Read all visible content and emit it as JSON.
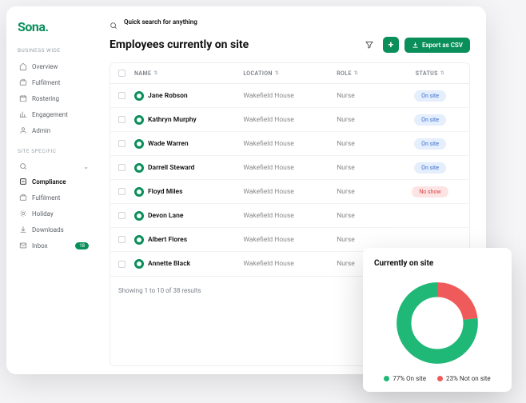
{
  "brand": {
    "name": "Sona",
    "dot": "."
  },
  "search": {
    "placeholder": "Quick search for anything"
  },
  "sidebar": {
    "section1_label": "BUSINESS WIDE",
    "section2_label": "SITE SPECIFIC",
    "items1": [
      {
        "label": "Overview"
      },
      {
        "label": "Fulfilment"
      },
      {
        "label": "Rostering"
      },
      {
        "label": "Engagement"
      },
      {
        "label": "Admin"
      }
    ],
    "items2": [
      {
        "label": "Compliance",
        "active": true
      },
      {
        "label": "Fulfilment"
      },
      {
        "label": "Holiday"
      },
      {
        "label": "Downloads"
      },
      {
        "label": "Inbox",
        "badge": "18"
      }
    ]
  },
  "page": {
    "title": "Employees currently on site",
    "export_label": "Export as CSV"
  },
  "table": {
    "headers": {
      "name": "NAME",
      "location": "LOCATION",
      "role": "ROLE",
      "status": "STATUS"
    },
    "rows": [
      {
        "name": "Jane Robson",
        "location": "Wakefield House",
        "role": "Nurse",
        "status": "On site",
        "status_class": "onsite"
      },
      {
        "name": "Kathryn Murphy",
        "location": "Wakefield House",
        "role": "Nurse",
        "status": "On site",
        "status_class": "onsite"
      },
      {
        "name": "Wade Warren",
        "location": "Wakefield House",
        "role": "Nurse",
        "status": "On site",
        "status_class": "onsite"
      },
      {
        "name": "Darrell Steward",
        "location": "Wakefield House",
        "role": "Nurse",
        "status": "On site",
        "status_class": "onsite"
      },
      {
        "name": "Floyd Miles",
        "location": "Wakefield House",
        "role": "Nurse",
        "status": "No show",
        "status_class": "noshow"
      },
      {
        "name": "Devon Lane",
        "location": "Wakefield House",
        "role": "Nurse",
        "status": "",
        "status_class": ""
      },
      {
        "name": "Albert Flores",
        "location": "Wakefield House",
        "role": "Nurse",
        "status": "",
        "status_class": ""
      },
      {
        "name": "Annette Black",
        "location": "Wakefield House",
        "role": "Nurse",
        "status": "",
        "status_class": ""
      }
    ],
    "footer": "Showing 1 to 10 of 38 results"
  },
  "overlay": {
    "title": "Currently on site",
    "legend": {
      "onsite": "77%  On site",
      "notonsite": "23%  Not on site"
    }
  },
  "chart_data": {
    "type": "pie",
    "title": "Currently on site",
    "series": [
      {
        "name": "On site",
        "value": 77,
        "color": "#1fb877"
      },
      {
        "name": "Not on site",
        "value": 23,
        "color": "#ef5b5b"
      }
    ]
  },
  "colors": {
    "brand": "#0a8f5b",
    "onsite": "#1fb877",
    "notonsite": "#ef5b5b"
  }
}
